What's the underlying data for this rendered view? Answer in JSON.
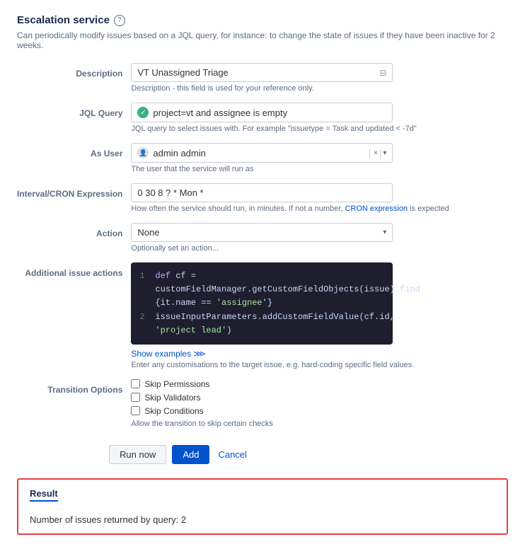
{
  "page": {
    "title": "Escalation service",
    "subtitle": "Can periodically modify issues based on a JQL query, for instance: to change the state of issues if they have been inactive for 2 weeks.",
    "info_icon_label": "?"
  },
  "form": {
    "description": {
      "label": "Description",
      "value": "VT Unassigned Triage",
      "hint": "Description - this field is used for your reference only."
    },
    "jql_query": {
      "label": "JQL Query",
      "value": "project=vt and assignee is empty",
      "hint": "JQL query to select issues with. For example \"issuetype = Task and updated < -7d\""
    },
    "as_user": {
      "label": "As User",
      "value": "admin admin",
      "hint": "The user that the service will run as",
      "clear_label": "×",
      "expand_label": "▾"
    },
    "interval_cron": {
      "label": "Interval/CRON Expression",
      "value": "0 30 8 ? * Mon *",
      "hint_before": "How often the service should run, in minutes. If not a number, ",
      "cron_link_label": "CRON expression",
      "hint_after": " is expected"
    },
    "action": {
      "label": "Action",
      "value": "None",
      "hint": "Optionally set an action..."
    },
    "additional_issue_actions": {
      "label": "Additional issue actions",
      "code_lines": [
        {
          "num": "1",
          "parts": [
            {
              "type": "kw",
              "text": "def"
            },
            {
              "type": "plain",
              "text": " cf = customFieldManager.getCustomFieldObjects(issue).find {it.name == "
            },
            {
              "type": "str",
              "text": "'assignee'"
            },
            {
              "type": "plain",
              "text": "}"
            }
          ]
        },
        {
          "num": "2",
          "parts": [
            {
              "type": "plain",
              "text": "issueInputParameters.addCustomFieldValue(cf.id, "
            },
            {
              "type": "str",
              "text": "'project lead'"
            },
            {
              "type": "plain",
              "text": ")"
            }
          ]
        }
      ],
      "show_examples_label": "Show examples ⋙",
      "hint": "Enter any customisations to the target issue, e.g. hard-coding specific field values."
    },
    "transition_options": {
      "label": "Transition Options",
      "options": [
        {
          "id": "skip_permissions",
          "label": "Skip Permissions"
        },
        {
          "id": "skip_validators",
          "label": "Skip Validators"
        },
        {
          "id": "skip_conditions",
          "label": "Skip Conditions"
        }
      ],
      "hint": "Allow the transition to skip certain checks"
    }
  },
  "buttons": {
    "run_now": "Run now",
    "add": "Add",
    "cancel": "Cancel"
  },
  "result": {
    "title": "Result",
    "text": "Number of issues returned by query: 2"
  }
}
